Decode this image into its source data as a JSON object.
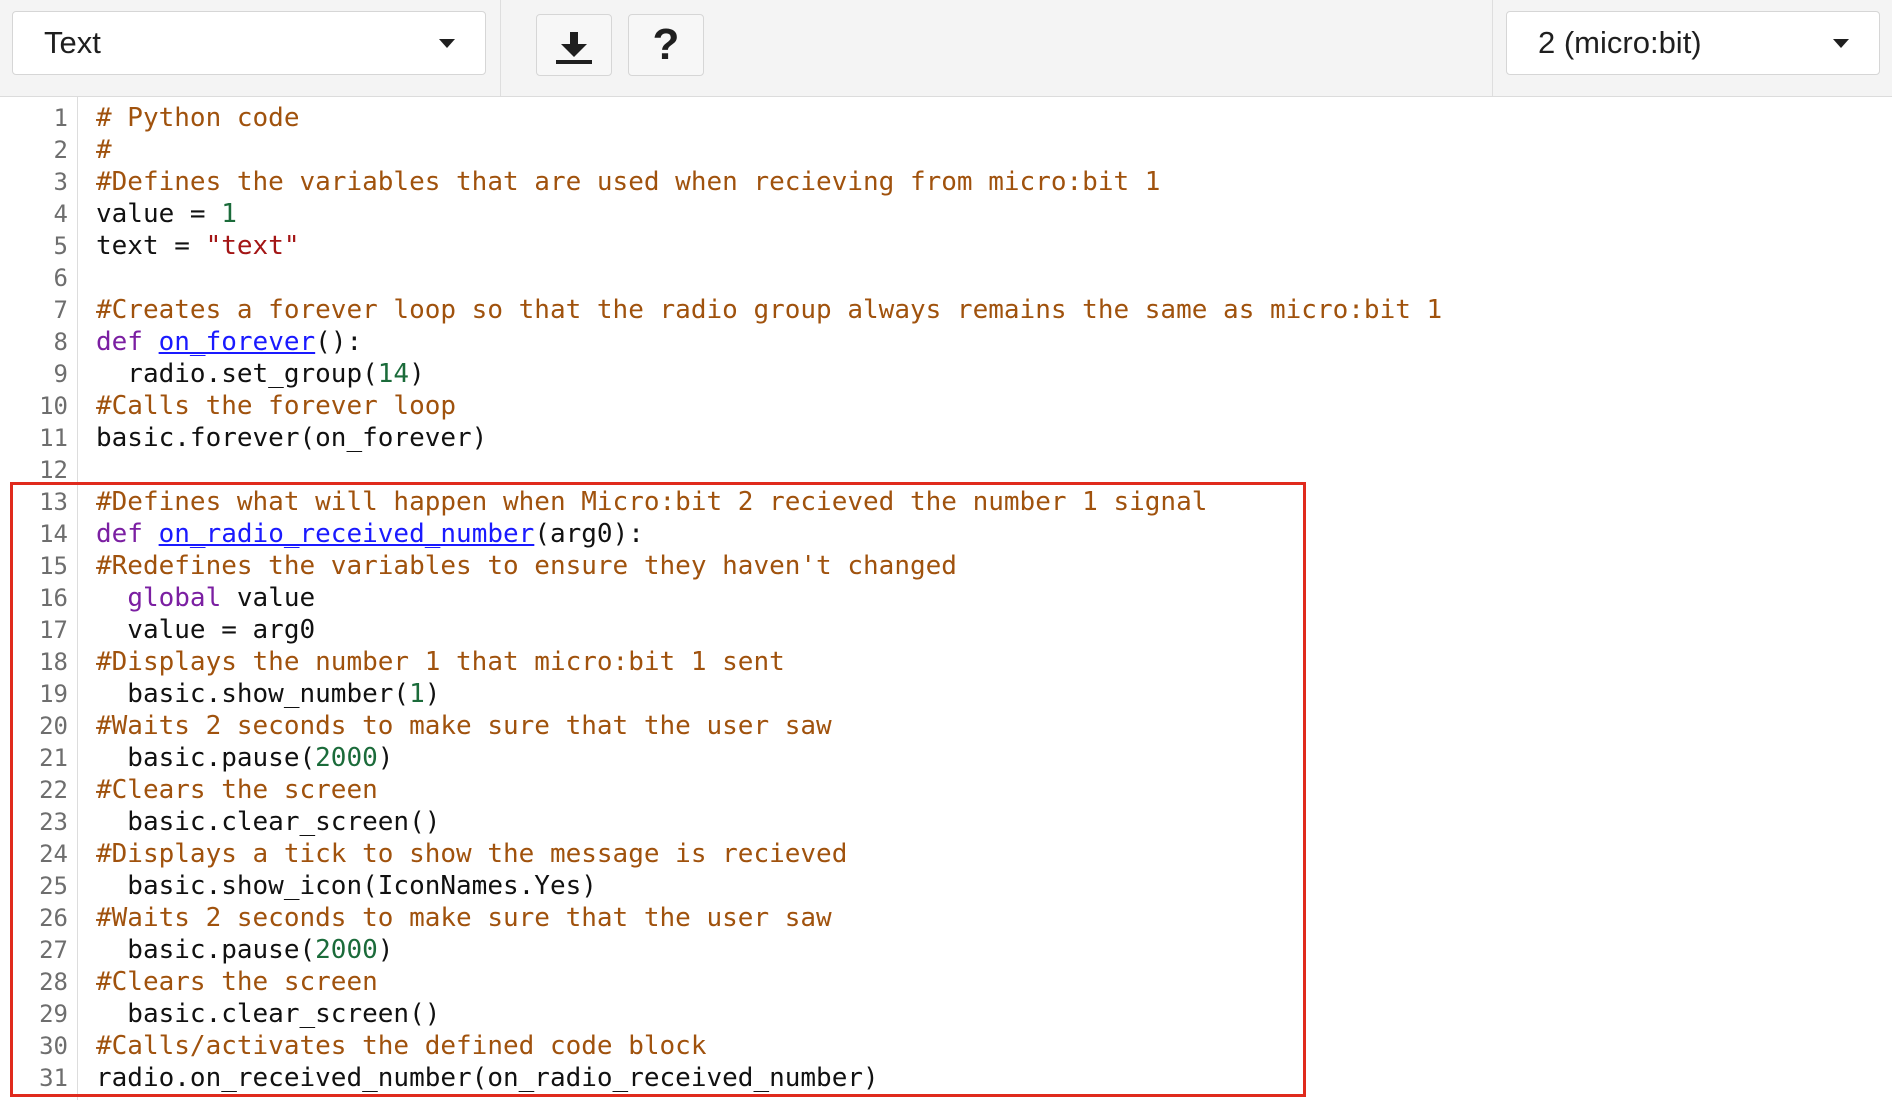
{
  "toolbar": {
    "language_dropdown": {
      "label": "Text"
    },
    "download_button": {
      "icon": "download-icon"
    },
    "help_button": {
      "icon": "help-icon",
      "glyph": "?"
    },
    "device_dropdown": {
      "label": "2 (micro:bit)"
    }
  },
  "editor": {
    "highlight": {
      "from_line": 13,
      "to_line": 31,
      "color": "#e02a1d"
    },
    "lines": [
      {
        "num": "1",
        "tokens": [
          {
            "t": "comment",
            "v": "# Python code"
          }
        ]
      },
      {
        "num": "2",
        "tokens": [
          {
            "t": "comment",
            "v": "#"
          }
        ]
      },
      {
        "num": "3",
        "tokens": [
          {
            "t": "comment",
            "v": "#Defines the variables that are used when recieving from micro:bit 1"
          }
        ]
      },
      {
        "num": "4",
        "tokens": [
          {
            "t": "plain",
            "v": "value = "
          },
          {
            "t": "number",
            "v": "1"
          }
        ]
      },
      {
        "num": "5",
        "tokens": [
          {
            "t": "plain",
            "v": "text = "
          },
          {
            "t": "string",
            "v": "\"text\""
          }
        ]
      },
      {
        "num": "6",
        "tokens": []
      },
      {
        "num": "7",
        "tokens": [
          {
            "t": "comment",
            "v": "#Creates a forever loop so that the radio group always remains the same as micro:bit 1"
          }
        ]
      },
      {
        "num": "8",
        "tokens": [
          {
            "t": "keyword",
            "v": "def "
          },
          {
            "t": "def",
            "v": "on_forever"
          },
          {
            "t": "plain",
            "v": "():"
          }
        ]
      },
      {
        "num": "9",
        "tokens": [
          {
            "t": "plain",
            "v": "  radio.set_group("
          },
          {
            "t": "number",
            "v": "14"
          },
          {
            "t": "plain",
            "v": ")"
          }
        ]
      },
      {
        "num": "10",
        "tokens": [
          {
            "t": "comment",
            "v": "#Calls the forever loop"
          }
        ]
      },
      {
        "num": "11",
        "tokens": [
          {
            "t": "plain",
            "v": "basic.forever(on_forever)"
          }
        ]
      },
      {
        "num": "12",
        "tokens": []
      },
      {
        "num": "13",
        "tokens": [
          {
            "t": "comment",
            "v": "#Defines what will happen when Micro:bit 2 recieved the number 1 signal"
          }
        ]
      },
      {
        "num": "14",
        "tokens": [
          {
            "t": "keyword",
            "v": "def "
          },
          {
            "t": "def",
            "v": "on_radio_received_number"
          },
          {
            "t": "plain",
            "v": "(arg0):"
          }
        ]
      },
      {
        "num": "15",
        "tokens": [
          {
            "t": "comment",
            "v": "#Redefines the variables to ensure they haven't changed"
          }
        ]
      },
      {
        "num": "16",
        "tokens": [
          {
            "t": "plain",
            "v": "  "
          },
          {
            "t": "keyword",
            "v": "global"
          },
          {
            "t": "plain",
            "v": " value"
          }
        ]
      },
      {
        "num": "17",
        "tokens": [
          {
            "t": "plain",
            "v": "  value = arg0"
          }
        ]
      },
      {
        "num": "18",
        "tokens": [
          {
            "t": "comment",
            "v": "#Displays the number 1 that micro:bit 1 sent"
          }
        ]
      },
      {
        "num": "19",
        "tokens": [
          {
            "t": "plain",
            "v": "  basic.show_number("
          },
          {
            "t": "number",
            "v": "1"
          },
          {
            "t": "plain",
            "v": ")"
          }
        ]
      },
      {
        "num": "20",
        "tokens": [
          {
            "t": "comment",
            "v": "#Waits 2 seconds to make sure that the user saw"
          }
        ]
      },
      {
        "num": "21",
        "tokens": [
          {
            "t": "plain",
            "v": "  basic.pause("
          },
          {
            "t": "number",
            "v": "2000"
          },
          {
            "t": "plain",
            "v": ")"
          }
        ]
      },
      {
        "num": "22",
        "tokens": [
          {
            "t": "comment",
            "v": "#Clears the screen"
          }
        ]
      },
      {
        "num": "23",
        "tokens": [
          {
            "t": "plain",
            "v": "  basic.clear_screen()"
          }
        ]
      },
      {
        "num": "24",
        "tokens": [
          {
            "t": "comment",
            "v": "#Displays a tick to show the message is recieved"
          }
        ]
      },
      {
        "num": "25",
        "tokens": [
          {
            "t": "plain",
            "v": "  basic.show_icon(IconNames.Yes)"
          }
        ]
      },
      {
        "num": "26",
        "tokens": [
          {
            "t": "comment",
            "v": "#Waits 2 seconds to make sure that the user saw"
          }
        ]
      },
      {
        "num": "27",
        "tokens": [
          {
            "t": "plain",
            "v": "  basic.pause("
          },
          {
            "t": "number",
            "v": "2000"
          },
          {
            "t": "plain",
            "v": ")"
          }
        ]
      },
      {
        "num": "28",
        "tokens": [
          {
            "t": "comment",
            "v": "#Clears the screen"
          }
        ]
      },
      {
        "num": "29",
        "tokens": [
          {
            "t": "plain",
            "v": "  basic.clear_screen()"
          }
        ]
      },
      {
        "num": "30",
        "tokens": [
          {
            "t": "comment",
            "v": "#Calls/activates the defined code block"
          }
        ]
      },
      {
        "num": "31",
        "tokens": [
          {
            "t": "plain",
            "v": "radio.on_received_number(on_radio_received_number)"
          }
        ]
      }
    ]
  }
}
